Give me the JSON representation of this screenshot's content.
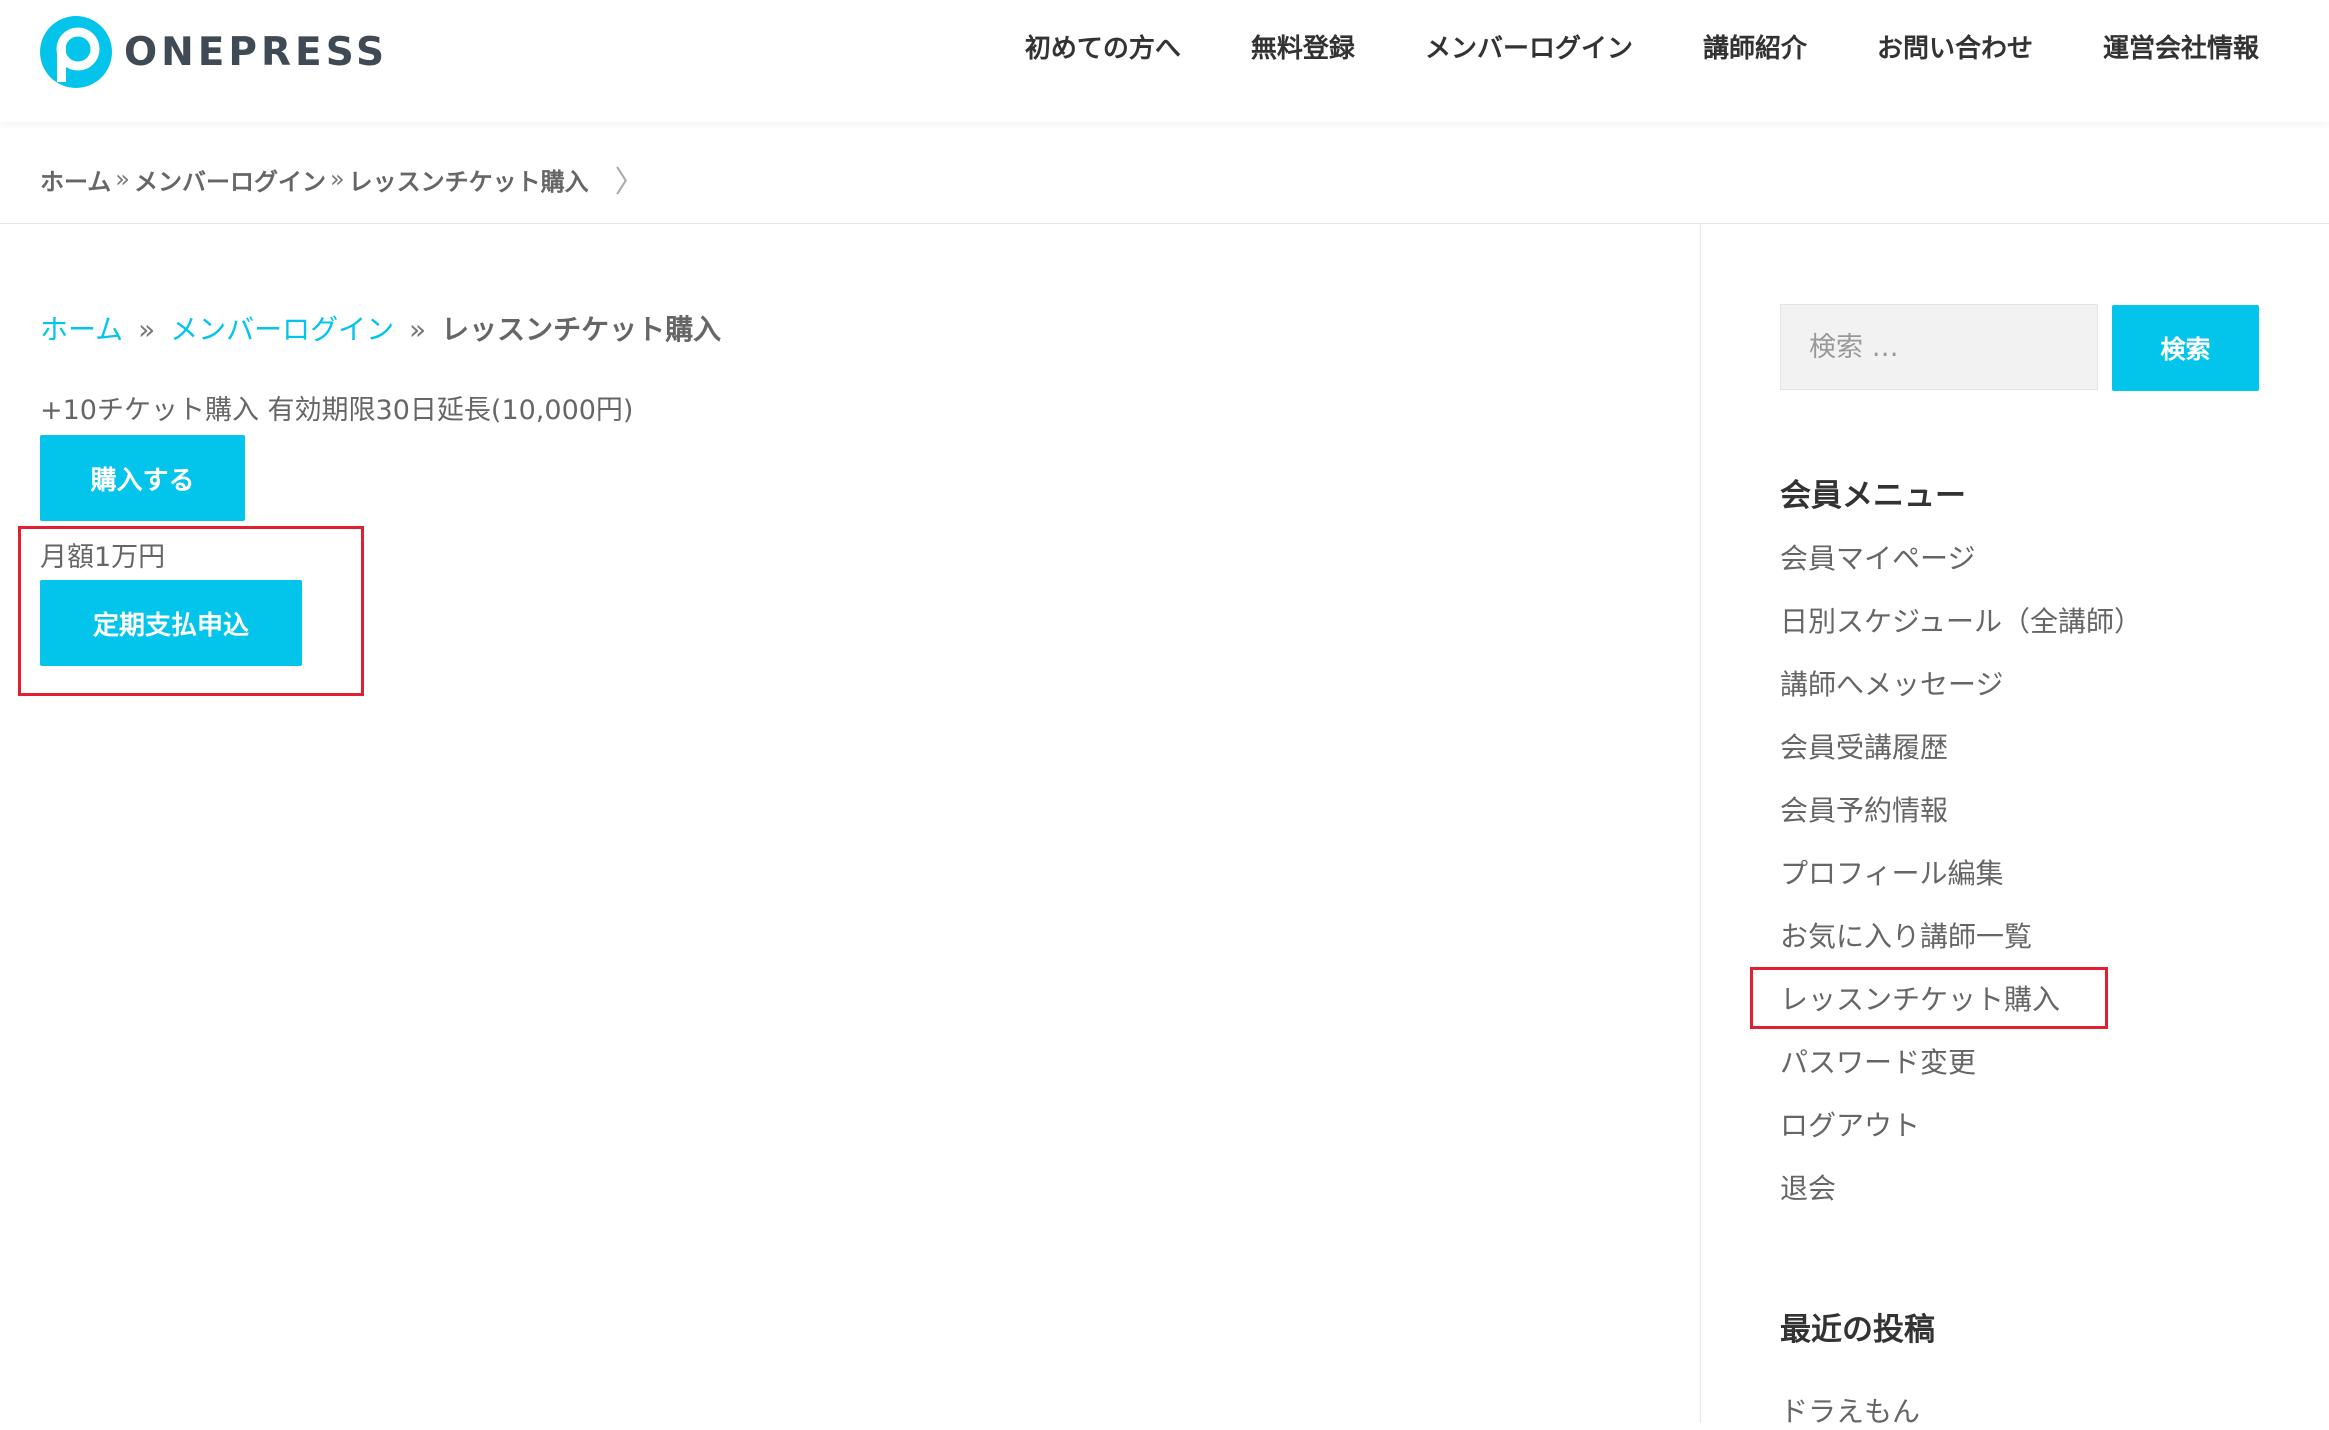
{
  "header": {
    "logo_text": "ONEPRESS",
    "nav": [
      "初めての方へ",
      "無料登録",
      "メンバーログイン",
      "講師紹介",
      "お問い合わせ",
      "運営会社情報"
    ]
  },
  "breadcrumb_top": {
    "home": "ホーム",
    "sep": "»",
    "parent": "メンバーログイン",
    "current": "レッスンチケット購入",
    "chevron": "〉"
  },
  "main": {
    "breadcrumb": {
      "home": "ホーム",
      "sep": "»",
      "parent": "メンバーログイン",
      "current": "レッスンチケット購入"
    },
    "product_line": "+10チケット購入 有効期限30日延長(10,000円)",
    "buy_button": "購入する",
    "monthly_label": "月額1万円",
    "subscribe_button": "定期支払申込"
  },
  "sidebar": {
    "search": {
      "placeholder": "検索 …",
      "button": "検索"
    },
    "member_menu_title": "会員メニュー",
    "member_menu": [
      "会員マイページ",
      "日別スケジュール（全講師）",
      "講師へメッセージ",
      "会員受講履歴",
      "会員予約情報",
      "プロフィール編集",
      "お気に入り講師一覧",
      "レッスンチケット購入",
      "パスワード変更",
      "ログアウト",
      "退会"
    ],
    "recent_posts_title": "最近の投稿",
    "recent_posts": [
      "ドラえもん"
    ]
  },
  "colors": {
    "accent": "#03c4eb",
    "highlight_box": "#e02030"
  }
}
